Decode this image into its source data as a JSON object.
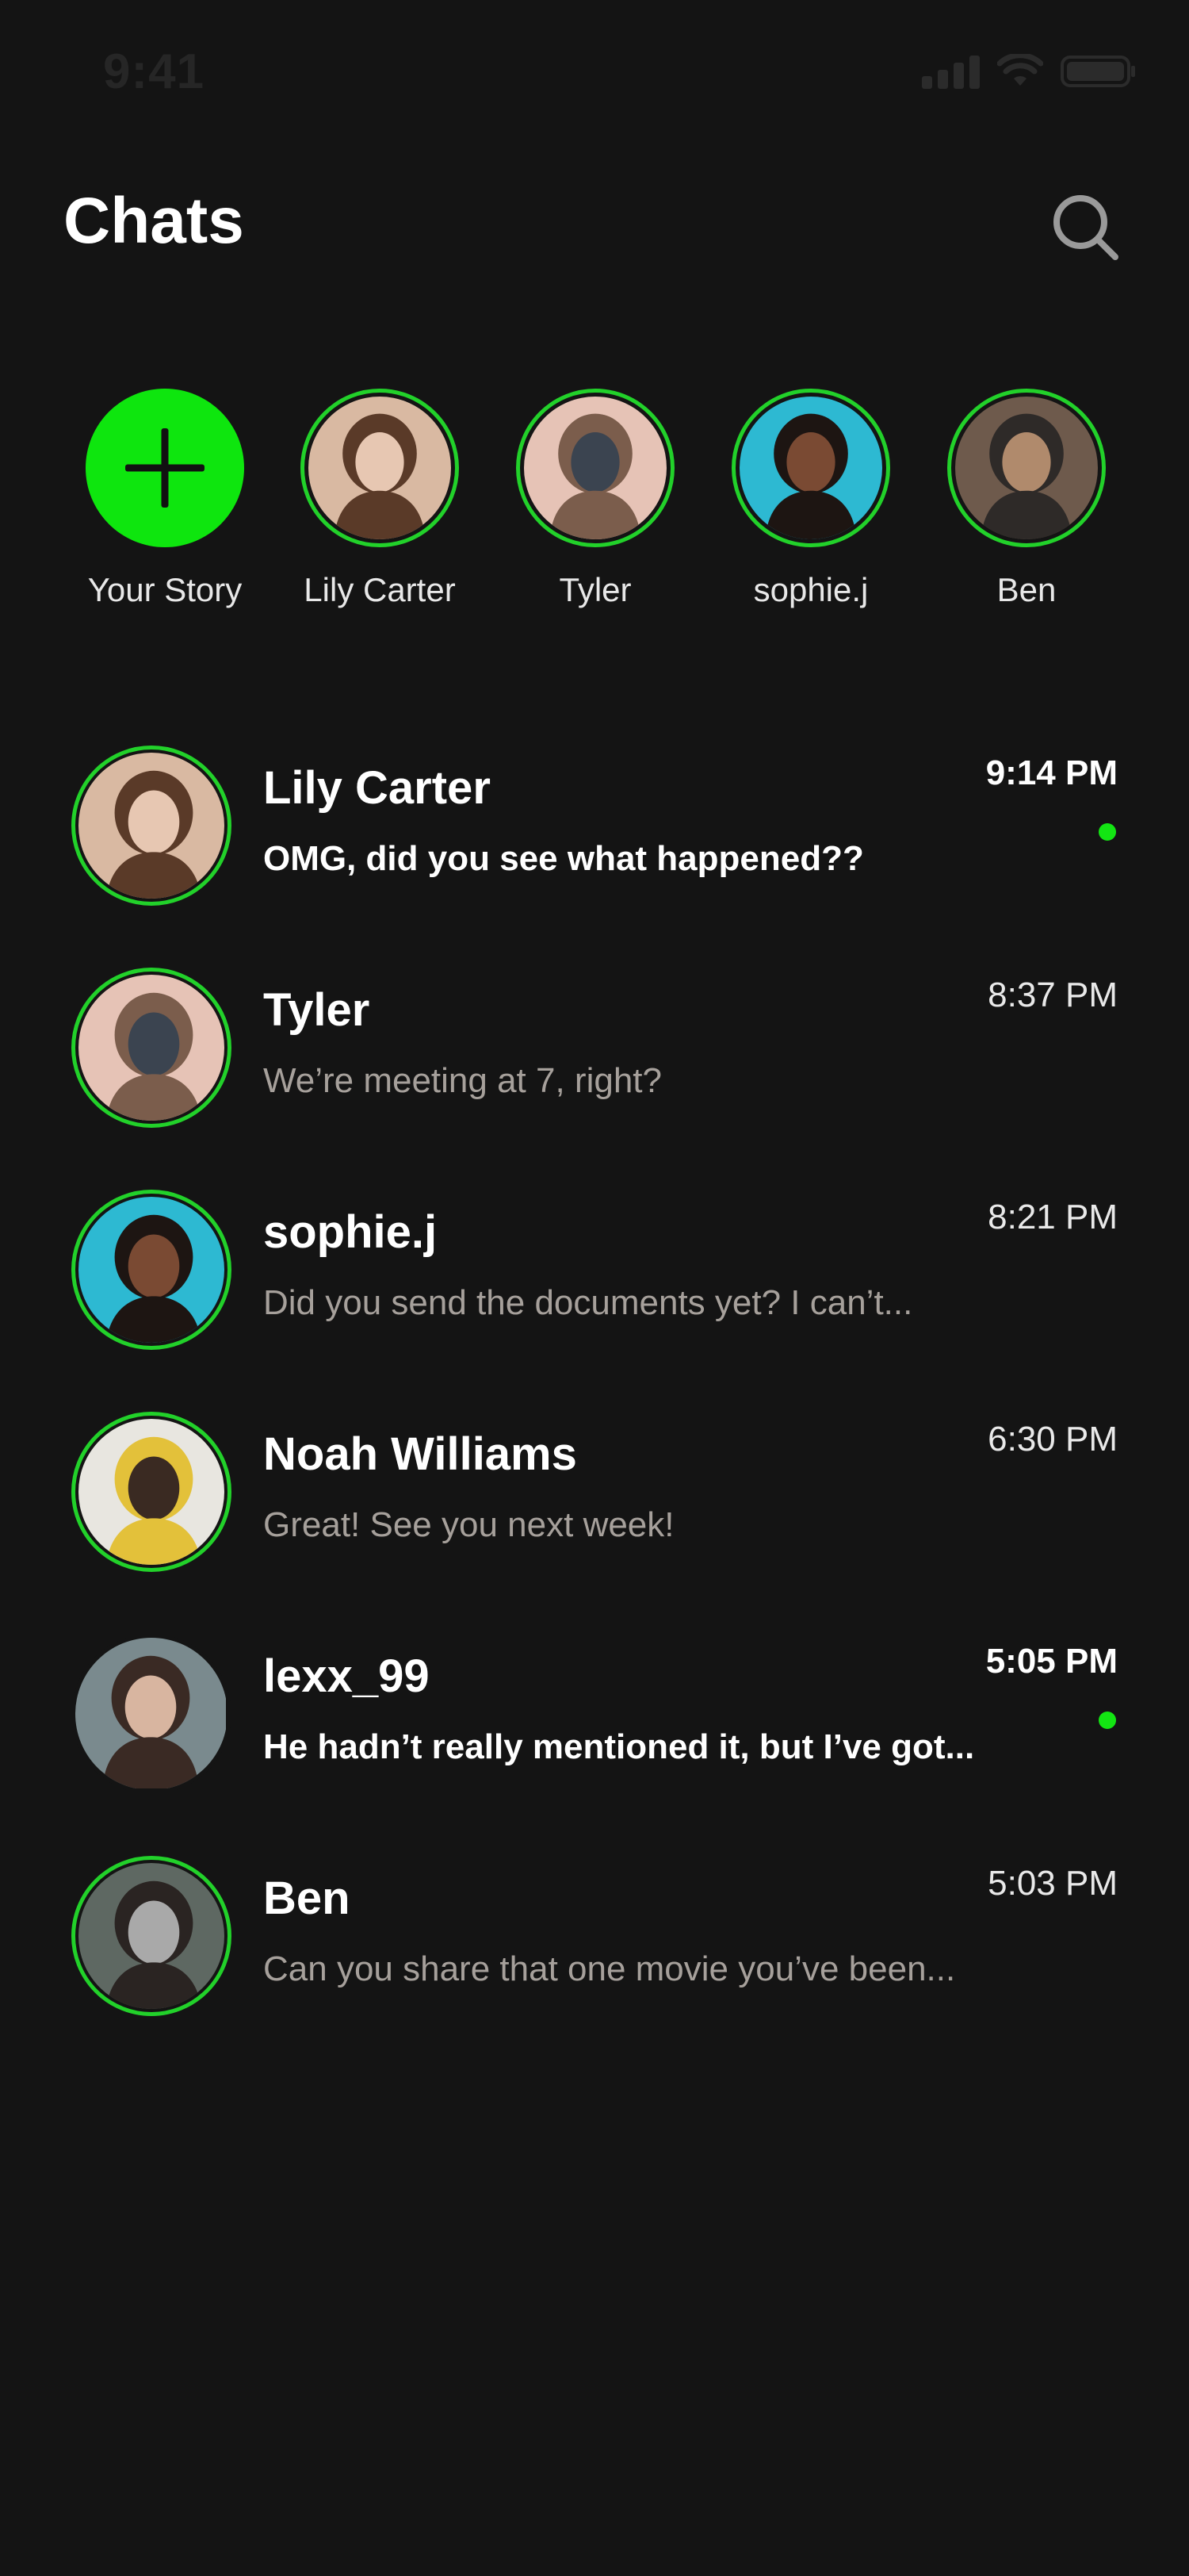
{
  "status_bar": {
    "time": "9:41"
  },
  "header": {
    "title": "Chats"
  },
  "accent_color": "#13e513",
  "stories": [
    {
      "label": "Your Story",
      "type": "add"
    },
    {
      "label": "Lily Carter",
      "palette": [
        "#d9b9a2",
        "#5a3a28",
        "#e7c7b2"
      ]
    },
    {
      "label": "Tyler",
      "palette": [
        "#e6c3b6",
        "#7b5d4c",
        "#3b4450"
      ]
    },
    {
      "label": "sophie.j",
      "palette": [
        "#2db9d2",
        "#1d1512",
        "#7a4a33"
      ]
    },
    {
      "label": "Ben",
      "palette": [
        "#6e5a4c",
        "#2e2a28",
        "#b08a6c"
      ]
    }
  ],
  "chats": [
    {
      "name": "Lily Carter",
      "message": "OMG, did you see what happened??",
      "time": "9:14 PM",
      "unread": true,
      "ring": true,
      "palette": [
        "#d9b9a2",
        "#5a3a28",
        "#e7c7b2"
      ]
    },
    {
      "name": "Tyler",
      "message": "We’re meeting at 7, right?",
      "time": "8:37 PM",
      "unread": false,
      "ring": true,
      "palette": [
        "#e6c3b6",
        "#7b5d4c",
        "#3b4450"
      ]
    },
    {
      "name": "sophie.j",
      "message": "Did you send the documents yet? I can’t...",
      "time": "8:21 PM",
      "unread": false,
      "ring": true,
      "palette": [
        "#2db9d2",
        "#1d1512",
        "#7a4a33"
      ]
    },
    {
      "name": "Noah Williams",
      "message": "Great! See you next week!",
      "time": "6:30 PM",
      "unread": false,
      "ring": true,
      "palette": [
        "#e8e6e0",
        "#e3c13a",
        "#3a2a22"
      ]
    },
    {
      "name": "lexx_99",
      "message": "He hadn’t really mentioned it, but I’ve got...",
      "time": "5:05 PM",
      "unread": true,
      "ring": false,
      "palette": [
        "#7a8a8e",
        "#3a2a24",
        "#d8b5a0"
      ]
    },
    {
      "name": "Ben",
      "message": "Can you share that one movie you’ve been...",
      "time": "5:03 PM",
      "unread": false,
      "ring": true,
      "palette": [
        "#5e6862",
        "#2a2422",
        "#a9a9a9"
      ]
    }
  ]
}
